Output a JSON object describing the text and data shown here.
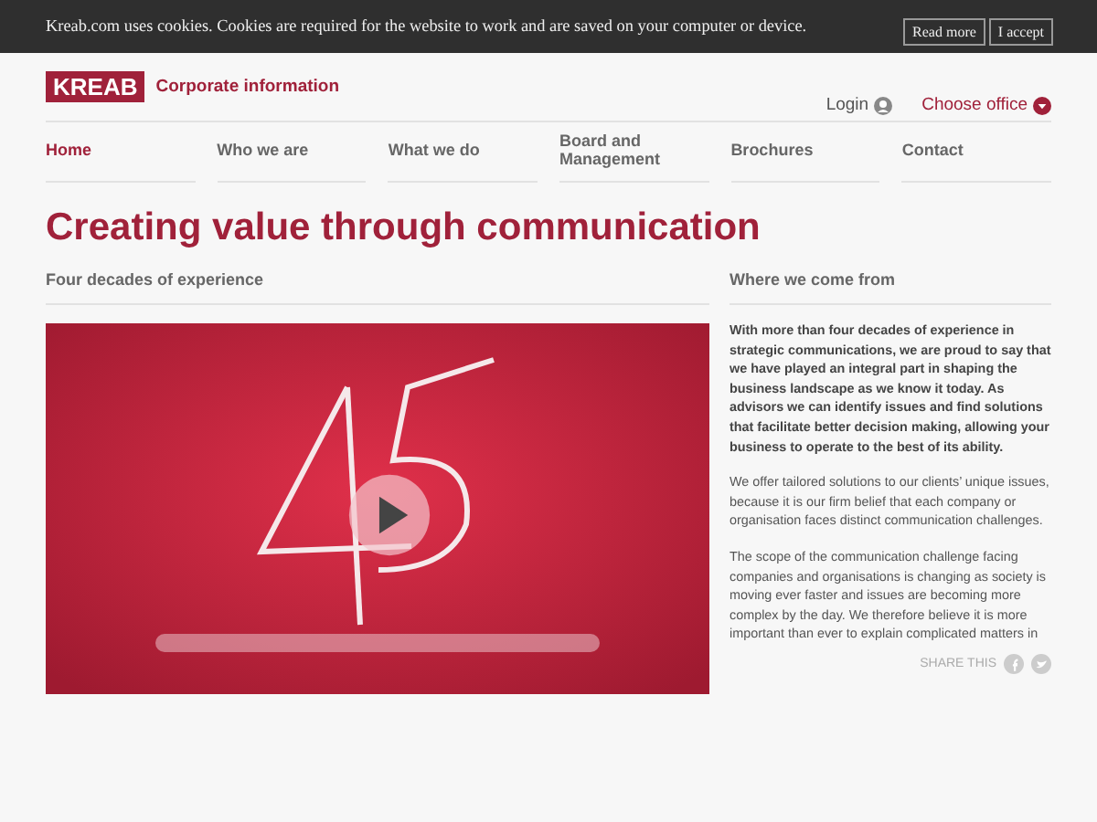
{
  "cookie_bar": {
    "text": "Kreab.com uses cookies. Cookies are required for the website to work and are saved on your computer or device.",
    "buttons": [
      "Read more",
      "I accept"
    ]
  },
  "header": {
    "logo": "KREAB",
    "subtitle": "Corporate information",
    "login": "Login",
    "office": "Choose office"
  },
  "nav": [
    {
      "label": "Home",
      "selected": true
    },
    {
      "label": "Who we are",
      "selected": false
    },
    {
      "label": "What we do",
      "selected": false
    },
    {
      "label": "Board and Management",
      "selected": false
    },
    {
      "label": "Brochures",
      "selected": false
    },
    {
      "label": "Contact",
      "selected": false
    }
  ],
  "title": "Creating value through communication",
  "left": {
    "heading": "Four decades of experience"
  },
  "right": {
    "heading": "Where we come from",
    "paragraphs": [
      "With more than four decades of experience in strategic communications, we are proud to say that we have played an integral part in shaping the business landscape as we know it today. As advisors we can identify issues and find solutions that facilitate better decision making, allowing your business to operate to the best of its ability.",
      "We offer tailored solutions to our clients’ unique issues, because it is our firm belief that each company or organisation faces distinct communication challenges.",
      "The scope of the communication challenge facing companies and organisations is changing as society is moving ever faster and issues are becoming more complex by the day. We therefore believe it is more important than ever to explain complicated matters in"
    ],
    "share": "SHARE THIS"
  }
}
